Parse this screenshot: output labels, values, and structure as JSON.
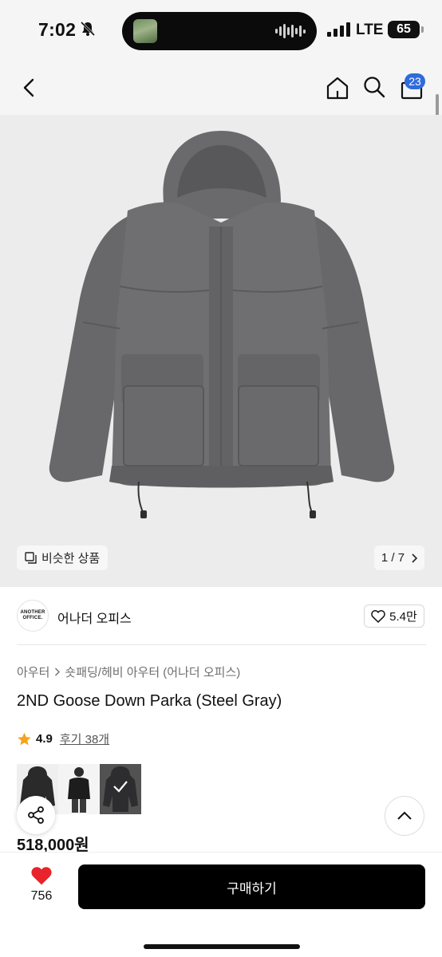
{
  "status_bar": {
    "time": "7:02",
    "network": "LTE",
    "battery": "65"
  },
  "nav": {
    "back_icon": "chevron-left-icon",
    "home_icon": "home-icon",
    "search_icon": "search-icon",
    "cart_icon": "shopping-bag-icon",
    "cart_badge": "23"
  },
  "hero": {
    "similar_label": "비슷한 상품",
    "page_indicator": "1 / 7",
    "product_color": "#6b6b6d"
  },
  "brand": {
    "logo_text_line1": "ANOTHER",
    "logo_text_line2": "OFFICE.",
    "name": "어나더 오피스",
    "likes": "5.4만"
  },
  "product": {
    "breadcrumb": [
      "아우터",
      "숏패딩/헤비 아우터 (어나더 오피스)"
    ],
    "title": "2ND Goose Down Parka (Steel Gray)",
    "rating": "4.9",
    "reviews_label": "후기 38개",
    "price": "518,000원"
  },
  "bottom": {
    "wish_count": "756",
    "buy_label": "구매하기"
  },
  "colors": {
    "accent_blue": "#2f6bdb",
    "heart_red": "#e8232c",
    "star_orange": "#f7a21b",
    "button_black": "#000000"
  }
}
